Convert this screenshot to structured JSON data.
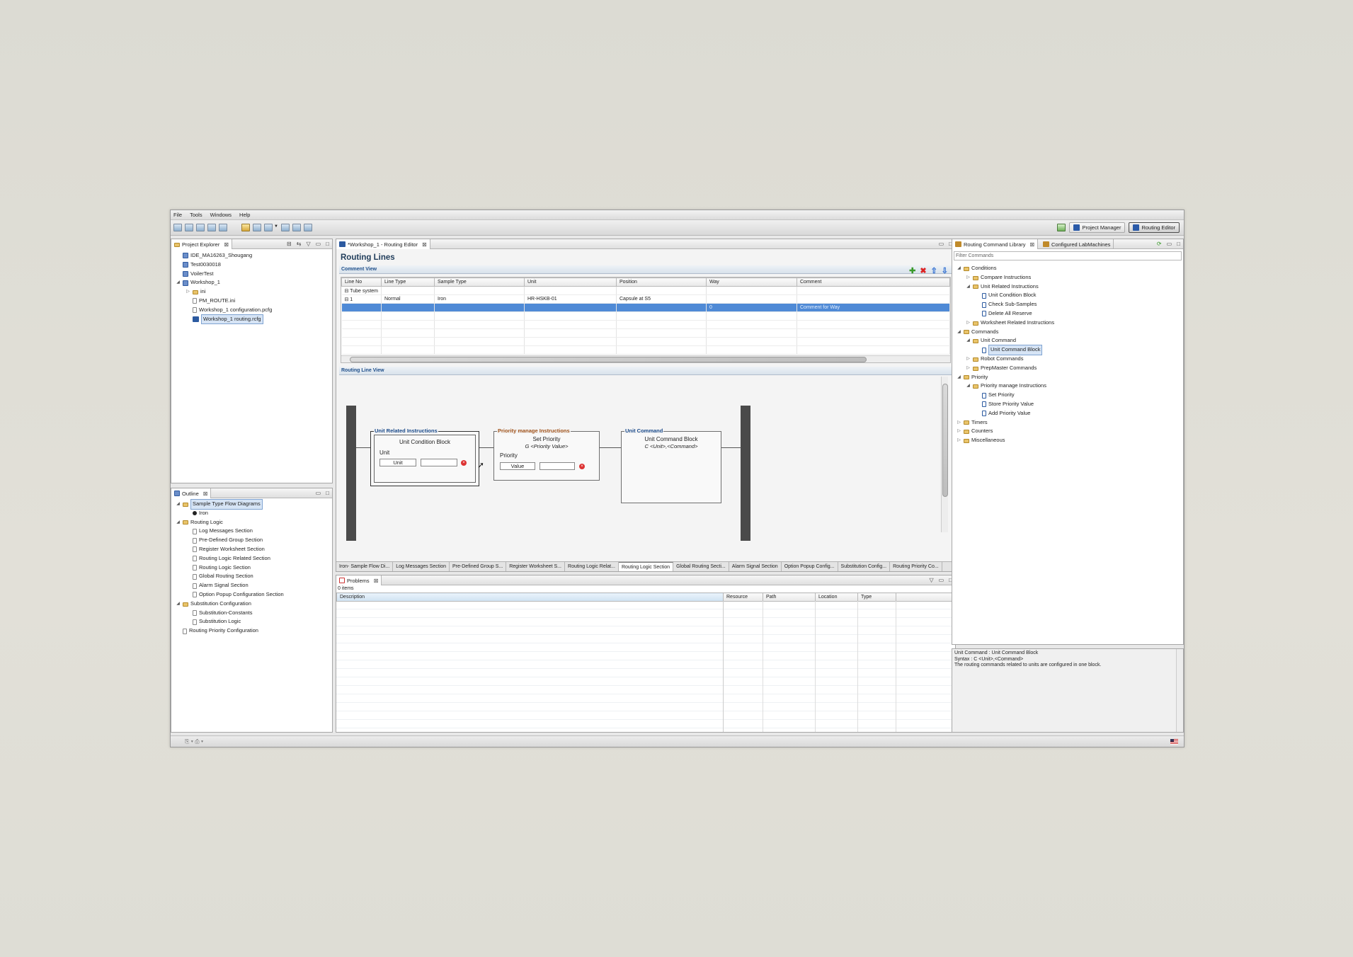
{
  "menu": [
    "File",
    "Tools",
    "Windows",
    "Help"
  ],
  "perspectives": {
    "project_manager": "Project Manager",
    "routing_editor": "Routing Editor"
  },
  "project_explorer": {
    "title": "Project Explorer",
    "items": [
      {
        "label": "IDE_MA16263_Shougang",
        "type": "project",
        "level": 1,
        "twisty": ""
      },
      {
        "label": "Test0030018",
        "type": "project",
        "level": 1,
        "twisty": ""
      },
      {
        "label": "VoilerTest",
        "type": "project",
        "level": 1,
        "twisty": ""
      },
      {
        "label": "Workshop_1",
        "type": "project",
        "level": 1,
        "twisty": "◢"
      },
      {
        "label": "ini",
        "type": "folder",
        "level": 2,
        "twisty": "▷"
      },
      {
        "label": "PM_ROUTE.ini",
        "type": "file",
        "level": 2,
        "twisty": ""
      },
      {
        "label": "Workshop_1 configuration.pcfg",
        "type": "file",
        "level": 2,
        "twisty": ""
      },
      {
        "label": "Workshop_1 routing.rcfg",
        "type": "re",
        "level": 2,
        "twisty": "",
        "selected": true
      }
    ]
  },
  "outline": {
    "title": "Outline",
    "items": [
      {
        "label": "Sample Type Flow Diagrams",
        "type": "folder",
        "level": 1,
        "twisty": "◢",
        "selected": true
      },
      {
        "label": "Iron",
        "type": "dot",
        "level": 2,
        "twisty": ""
      },
      {
        "label": "Routing Logic",
        "type": "folder",
        "level": 1,
        "twisty": "◢"
      },
      {
        "label": "Log Messages Section",
        "type": "file",
        "level": 2,
        "twisty": ""
      },
      {
        "label": "Pre-Defined Group Section",
        "type": "file",
        "level": 2,
        "twisty": ""
      },
      {
        "label": "Register Worksheet Section",
        "type": "file",
        "level": 2,
        "twisty": ""
      },
      {
        "label": "Routing Logic Related Section",
        "type": "file",
        "level": 2,
        "twisty": ""
      },
      {
        "label": "Routing Logic Section",
        "type": "file",
        "level": 2,
        "twisty": ""
      },
      {
        "label": "Global Routing Section",
        "type": "file",
        "level": 2,
        "twisty": ""
      },
      {
        "label": "Alarm Signal Section",
        "type": "file",
        "level": 2,
        "twisty": ""
      },
      {
        "label": "Option Popup Configuration Section",
        "type": "file",
        "level": 2,
        "twisty": ""
      },
      {
        "label": "Substitution Configuration",
        "type": "folder",
        "level": 1,
        "twisty": "◢"
      },
      {
        "label": "Substitution-Constants",
        "type": "file",
        "level": 2,
        "twisty": ""
      },
      {
        "label": "Substitution Logic",
        "type": "file",
        "level": 2,
        "twisty": ""
      },
      {
        "label": "Routing Priority Configuration",
        "type": "file",
        "level": 1,
        "twisty": ""
      }
    ]
  },
  "editor": {
    "tab": "*Workshop_1 - Routing Editor",
    "title": "Routing Lines",
    "comment_view": "Comment View",
    "columns": [
      "Line No",
      "Line Type",
      "Sample Type",
      "Unit",
      "Position",
      "Way",
      "Comment"
    ],
    "rows": [
      [
        "⊟ Tube system",
        "",
        "",
        "",
        "",
        "",
        ""
      ],
      [
        "  ⊟ 1",
        "Normal",
        "Iron",
        "HR-HSKB-01",
        "Capsule at S5",
        "",
        ""
      ],
      [
        "",
        "",
        "",
        "",
        "",
        "0",
        "Comment for Way"
      ]
    ],
    "routing_line_view": "Routing Line View",
    "blocks": {
      "b1": {
        "label": "Unit Related Instructions",
        "title": "Unit Condition Block",
        "field_label": "Unit",
        "value": "Unit"
      },
      "b2": {
        "label": "Priority manage Instructions",
        "title": "Set Priority",
        "syntax": "G <Priority Value>",
        "field_label": "Priority",
        "value": "Value"
      },
      "b3": {
        "label": "Unit Command",
        "title": "Unit Command Block",
        "syntax": "C <Unit>,<Command>"
      }
    },
    "bottom_tabs": [
      "Iron- Sample Flow Di...",
      "Log Messages Section",
      "Pre-Defined Group S...",
      "Register Worksheet S...",
      "Routing Logic Relat...",
      "Routing Logic Section",
      "Global Routing Secti...",
      "Alarm Signal Section",
      "Option Popup Config...",
      "Substitution Config...",
      "Routing Priority Co..."
    ],
    "active_bottom_tab": 5
  },
  "problems": {
    "title": "Problems",
    "count": "0 items",
    "columns": [
      "Description",
      "Resource",
      "Path",
      "Location",
      "Type"
    ]
  },
  "library": {
    "tab1": "Routing Command Library",
    "tab2": "Configured LabMachines",
    "filter_placeholder": "Filter Commands",
    "items": [
      {
        "label": "Conditions",
        "type": "folder",
        "level": 1,
        "twisty": "◢"
      },
      {
        "label": "Compare Instructions",
        "type": "folder",
        "level": 2,
        "twisty": "▷"
      },
      {
        "label": "Unit Related Instructions",
        "type": "folder",
        "level": 2,
        "twisty": "◢"
      },
      {
        "label": "Unit Condition Block",
        "type": "cmd",
        "level": 3,
        "twisty": ""
      },
      {
        "label": "Check Sub-Samples",
        "type": "cmd",
        "level": 3,
        "twisty": ""
      },
      {
        "label": "Delete All Reserve",
        "type": "cmd",
        "level": 3,
        "twisty": ""
      },
      {
        "label": "Worksheet Related Instructions",
        "type": "folder",
        "level": 2,
        "twisty": "▷"
      },
      {
        "label": "Commands",
        "type": "folder",
        "level": 1,
        "twisty": "◢"
      },
      {
        "label": "Unit Command",
        "type": "folder",
        "level": 2,
        "twisty": "◢"
      },
      {
        "label": "Unit Command Block",
        "type": "cmd",
        "level": 3,
        "twisty": "",
        "selected": true
      },
      {
        "label": "Robot Commands",
        "type": "folder",
        "level": 2,
        "twisty": "▷"
      },
      {
        "label": "PrepMaster Commands",
        "type": "folder",
        "level": 2,
        "twisty": "▷"
      },
      {
        "label": "Priority",
        "type": "folder",
        "level": 1,
        "twisty": "◢"
      },
      {
        "label": "Priority manage Instructions",
        "type": "folder",
        "level": 2,
        "twisty": "◢"
      },
      {
        "label": "Set Priority",
        "type": "cmd",
        "level": 3,
        "twisty": ""
      },
      {
        "label": "Store Priority Value",
        "type": "cmd",
        "level": 3,
        "twisty": ""
      },
      {
        "label": "Add Priority Value",
        "type": "cmd",
        "level": 3,
        "twisty": ""
      },
      {
        "label": "Timers",
        "type": "folder",
        "level": 1,
        "twisty": "▷"
      },
      {
        "label": "Counters",
        "type": "folder",
        "level": 1,
        "twisty": "▷"
      },
      {
        "label": "Miscellaneous",
        "type": "folder",
        "level": 1,
        "twisty": "▷"
      }
    ],
    "desc_line1": "Unit Command : Unit Command Block",
    "desc_line2": "Syntax : C <Unit>,<Command>",
    "desc_line3": "The routing commands related to units are configured in one block."
  },
  "colors": {
    "accent": "#2c5aa0",
    "selection": "#4f8ad6",
    "priority_label": "#a0521a",
    "unit_label": "#1a4a8a",
    "error": "#d33333"
  }
}
